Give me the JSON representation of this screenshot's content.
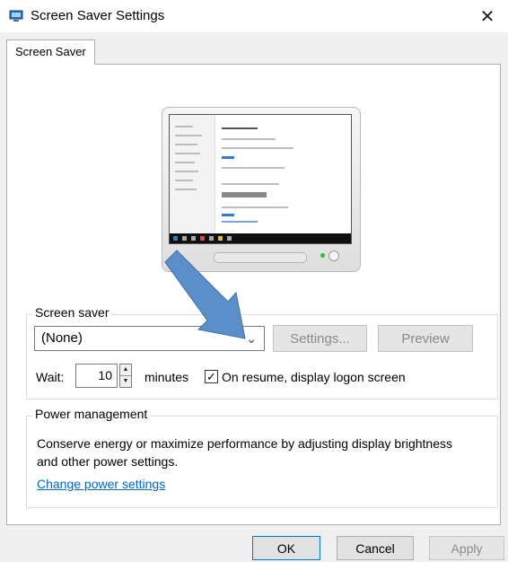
{
  "window": {
    "title": "Screen Saver Settings",
    "close_glyph": "✕",
    "icon": "monitor-icon"
  },
  "tabs": [
    {
      "label": "Screen Saver",
      "active": true
    }
  ],
  "screen_saver": {
    "group_label": "Screen saver",
    "selected": "(None)",
    "settings_label": "Settings...",
    "preview_label": "Preview",
    "wait_label": "Wait:",
    "wait_value": "10",
    "minutes_label": "minutes",
    "logon_checked": true,
    "logon_label": "On resume, display logon screen"
  },
  "power": {
    "group_label": "Power management",
    "description": "Conserve energy or maximize performance by adjusting display brightness and other power settings.",
    "link": "Change power settings"
  },
  "footer": {
    "ok_label": "OK",
    "cancel_label": "Cancel",
    "apply_label": "Apply"
  },
  "colors": {
    "link": "#0066cc",
    "arrow": "#5b8fc9",
    "focus_border": "#0078d7"
  }
}
